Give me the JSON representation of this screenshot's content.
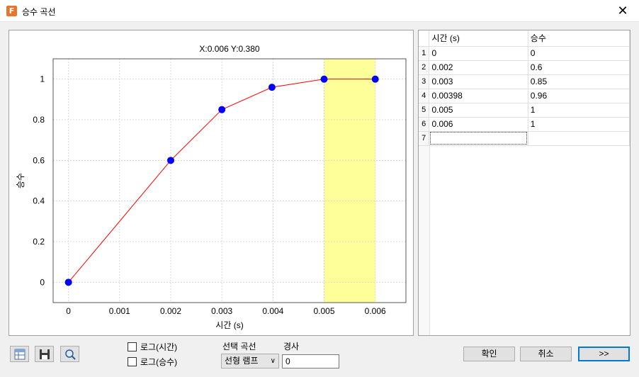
{
  "window": {
    "title": "승수 곡선",
    "close_symbol": "✕",
    "app_icon_letter": "F"
  },
  "chart_data": {
    "type": "line",
    "title": "X:0.006 Y:0.380",
    "xlabel": "시간 (s)",
    "ylabel": "승수",
    "x": [
      0,
      0.002,
      0.003,
      0.00398,
      0.005,
      0.006
    ],
    "y": [
      0,
      0.6,
      0.85,
      0.96,
      1,
      1
    ],
    "xlim": [
      -0.0003,
      0.0066
    ],
    "ylim": [
      -0.1,
      1.1
    ],
    "xticks": [
      0,
      0.001,
      0.002,
      0.003,
      0.004,
      0.005,
      0.006
    ],
    "xtick_labels": [
      "0",
      "0.001",
      "0.002",
      "0.003",
      "0.004",
      "0.005",
      "0.006"
    ],
    "yticks": [
      0,
      0.2,
      0.4,
      0.6,
      0.8,
      1
    ],
    "ytick_labels": [
      "0",
      "0.2",
      "0.4",
      "0.6",
      "0.8",
      "1"
    ],
    "highlight_range": [
      0.005,
      0.006
    ],
    "grid": true,
    "colors": {
      "line": "#ff0000",
      "marker": "#0000ff",
      "highlight": "#ffff99",
      "grid": "#d8d8d8"
    }
  },
  "table": {
    "headers": [
      "시간 (s)",
      "승수"
    ],
    "rows": [
      {
        "index": "1",
        "time": "0",
        "mult": "0"
      },
      {
        "index": "2",
        "time": "0.002",
        "mult": "0.6"
      },
      {
        "index": "3",
        "time": "0.003",
        "mult": "0.85"
      },
      {
        "index": "4",
        "time": "0.00398",
        "mult": "0.96"
      },
      {
        "index": "5",
        "time": "0.005",
        "mult": "1"
      },
      {
        "index": "6",
        "time": "0.006",
        "mult": "1"
      },
      {
        "index": "7",
        "time": "",
        "mult": ""
      }
    ]
  },
  "toolbar": {
    "icons": [
      "table-view-icon",
      "save-icon",
      "zoom-icon"
    ]
  },
  "options": {
    "log_time_label": "로그(시간)",
    "log_mult_label": "로그(승수)",
    "select_curve_label": "선택 곡선",
    "select_curve_value": "선형 램프",
    "slope_label": "경사",
    "slope_value": "0"
  },
  "buttons": {
    "ok": "확인",
    "cancel": "취소",
    "next": ">>"
  }
}
